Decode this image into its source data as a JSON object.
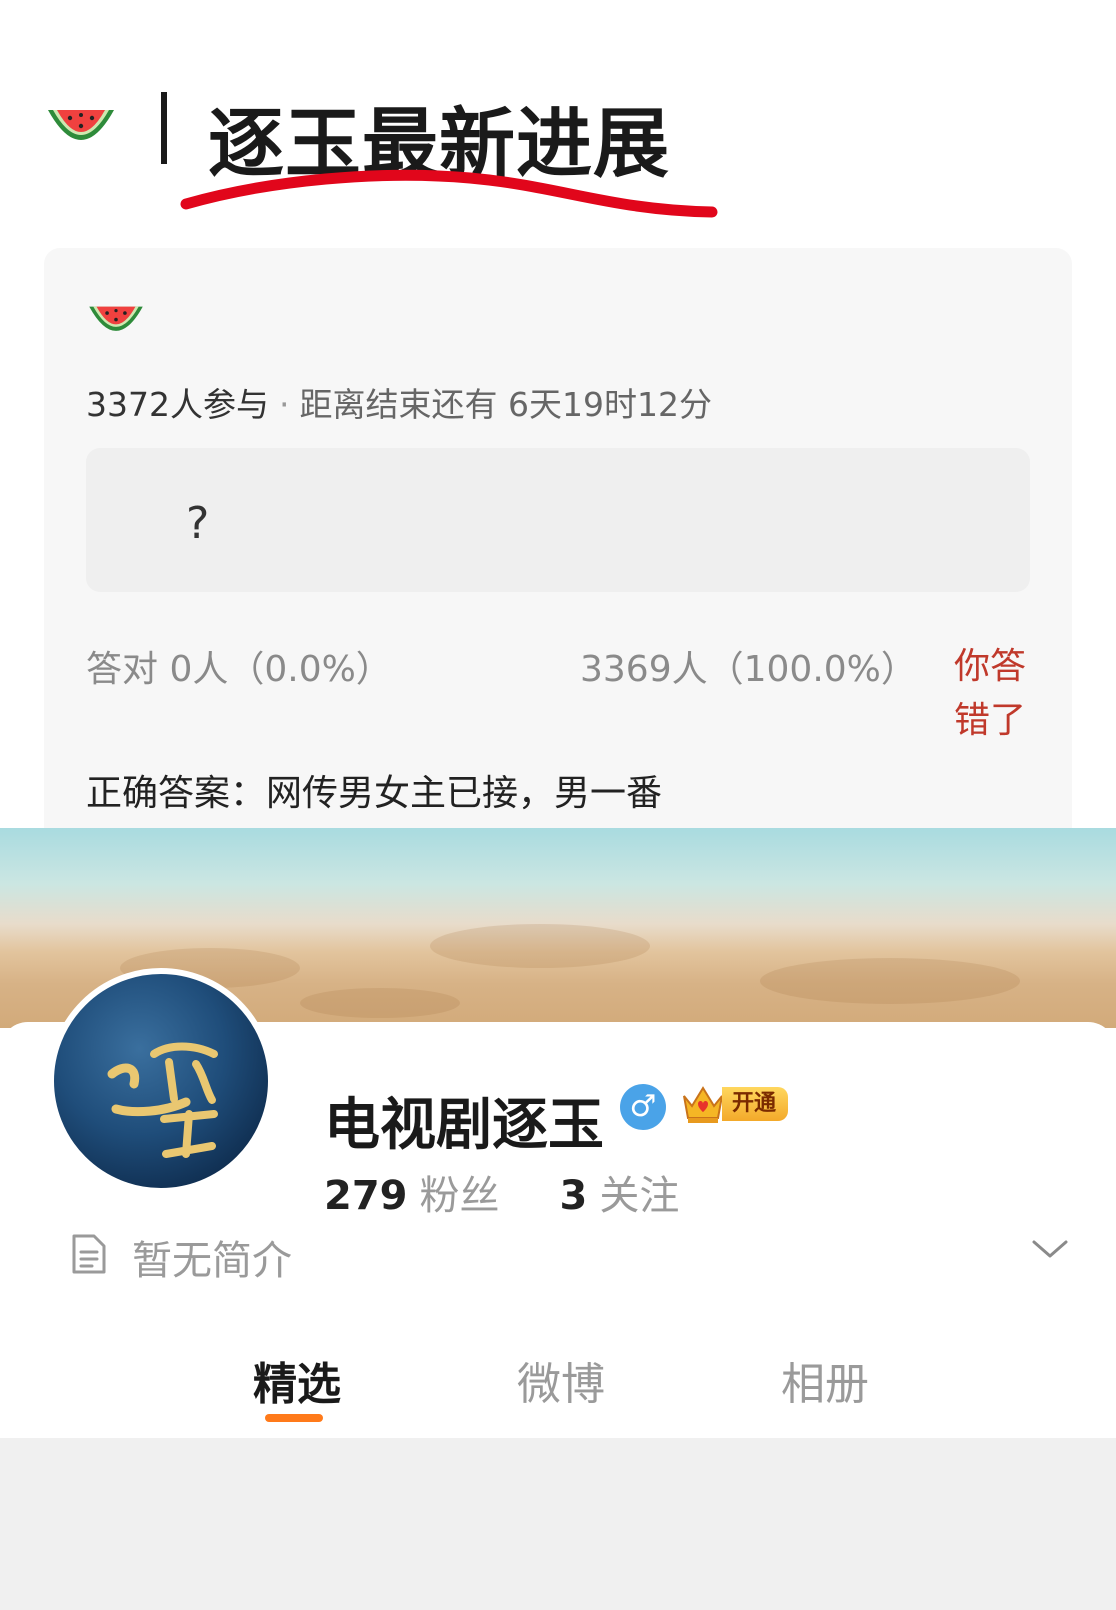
{
  "header": {
    "icon": "watermelon-icon",
    "title": "逐玉最新进展",
    "underline_color": "#e1061b"
  },
  "quiz": {
    "icon": "watermelon-icon",
    "participants": "3372人参与",
    "separator": "·",
    "countdown": "距离结束还有 6天19时12分",
    "question": "?",
    "correct_stat": "答对  0人（0.0%）",
    "wrong_stat": "3369人（100.0%）",
    "result": "你答错了",
    "answer": "正确答案：网传男女主已接，男一番",
    "result_color": "#c0392b"
  },
  "profile": {
    "avatar": "avatar-calligraphy",
    "name": "电视剧逐玉",
    "gender_icon": "male-icon",
    "gender_symbol": "♂",
    "vip_label": "开通",
    "followers_count": "279",
    "followers_label": "粉丝",
    "following_count": "3",
    "following_label": "关注",
    "intro": "暂无简介",
    "tabs": [
      {
        "label": "精选",
        "active": true
      },
      {
        "label": "微博",
        "active": false
      },
      {
        "label": "相册",
        "active": false
      }
    ],
    "accent_color": "#ff7a1a"
  }
}
